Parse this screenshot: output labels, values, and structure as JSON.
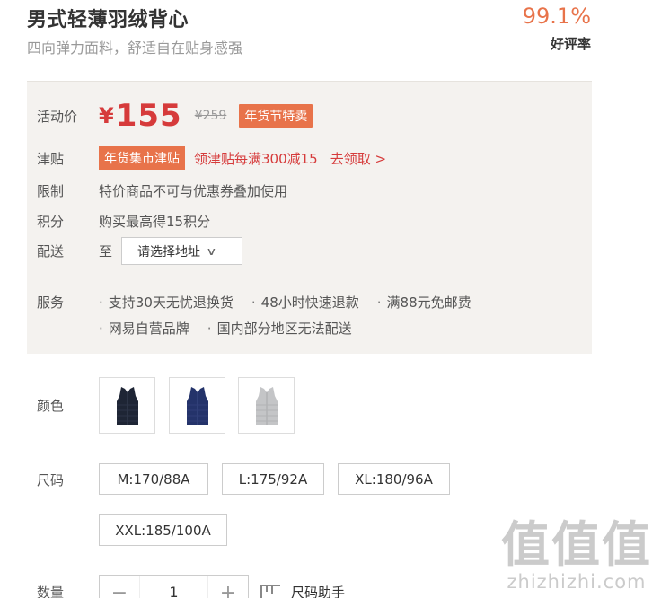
{
  "product": {
    "title": "男式轻薄羽绒背心",
    "subtitle": "四向弹力面料，舒适自在贴身感强"
  },
  "rating": {
    "value": "99.1%",
    "label": "好评率"
  },
  "price": {
    "label": "活动价",
    "symbol": "¥",
    "current": "155",
    "original": "¥259",
    "badge": "年货节特卖"
  },
  "jintie": {
    "label": "津贴",
    "badge": "年货集市津贴",
    "text": "领津贴每满300减15",
    "link": "去领取 >"
  },
  "restriction": {
    "label": "限制",
    "text": "特价商品不可与优惠券叠加使用"
  },
  "points": {
    "label": "积分",
    "text": "购买最高得15积分"
  },
  "delivery": {
    "label": "配送",
    "to": "至",
    "placeholder": "请选择地址"
  },
  "services": {
    "label": "服务",
    "items": [
      "支持30天无忧退换货",
      "48小时快速退款",
      "满88元免邮费",
      "网易自营品牌",
      "国内部分地区无法配送"
    ]
  },
  "color": {
    "label": "颜色",
    "options": [
      {
        "name": "dark-navy",
        "hex": "#1e2535"
      },
      {
        "name": "blue",
        "hex": "#24336a"
      },
      {
        "name": "light-gray",
        "hex": "#c4c5c7"
      }
    ]
  },
  "size": {
    "label": "尺码",
    "options": [
      "M:170/88A",
      "L:175/92A",
      "XL:180/96A",
      "XXL:185/100A"
    ]
  },
  "quantity": {
    "label": "数量",
    "minus": "−",
    "value": "1",
    "plus": "+"
  },
  "size_helper": {
    "label": "尺码助手"
  },
  "watermark": {
    "glyphs": "值值值",
    "url": "zhizhizhi.com"
  },
  "colors": {
    "accent": "#e8734a",
    "price": "#d63b3b",
    "panel_bg": "#f4f2ef"
  }
}
